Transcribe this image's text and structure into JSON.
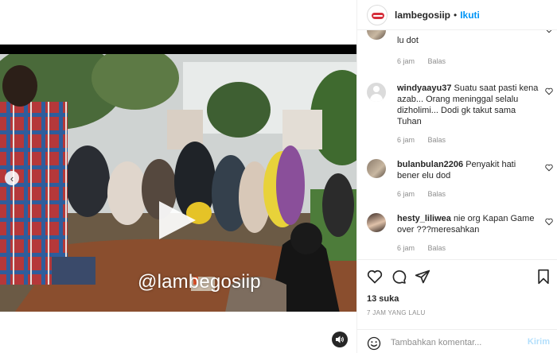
{
  "post": {
    "watermark": "@lambegosiip"
  },
  "header": {
    "username": "lambegosiip",
    "separator": "•",
    "follow_label": "Ikuti"
  },
  "comments": [
    {
      "username": "",
      "text": "lu dot",
      "time": "6 jam",
      "reply": "Balas",
      "avatar": "photo1"
    },
    {
      "username": "windyaayu37",
      "text": "Suatu saat pasti kena azab... Orang meninggal selalu dizholimi... Dodi gk takut sama Tuhan",
      "time": "6 jam",
      "reply": "Balas",
      "avatar": "generic"
    },
    {
      "username": "bulanbulan2206",
      "text": "Penyakit hati bener elu dod",
      "time": "6 jam",
      "reply": "Balas",
      "avatar": "photo1"
    },
    {
      "username": "hesty_liliwea",
      "text": "nie org Kapan Game over ???meresahkan",
      "time": "6 jam",
      "reply": "Balas",
      "avatar": "photo2"
    }
  ],
  "footer": {
    "likes": "13 suka",
    "time_ago": "7 JAM YANG LALU",
    "comment_placeholder": "Tambahkan komentar...",
    "send_label": "Kirim"
  },
  "icons": {
    "like": "heart-icon",
    "comment": "comment-icon",
    "share": "share-icon",
    "save": "bookmark-icon",
    "emoji": "emoji-icon",
    "mute": "speaker-icon",
    "prev": "chevron-left-icon",
    "play": "play-icon"
  },
  "colors": {
    "accent": "#0095f6",
    "send_disabled": "#b2dffc",
    "muted_text": "#8e8e8e"
  }
}
